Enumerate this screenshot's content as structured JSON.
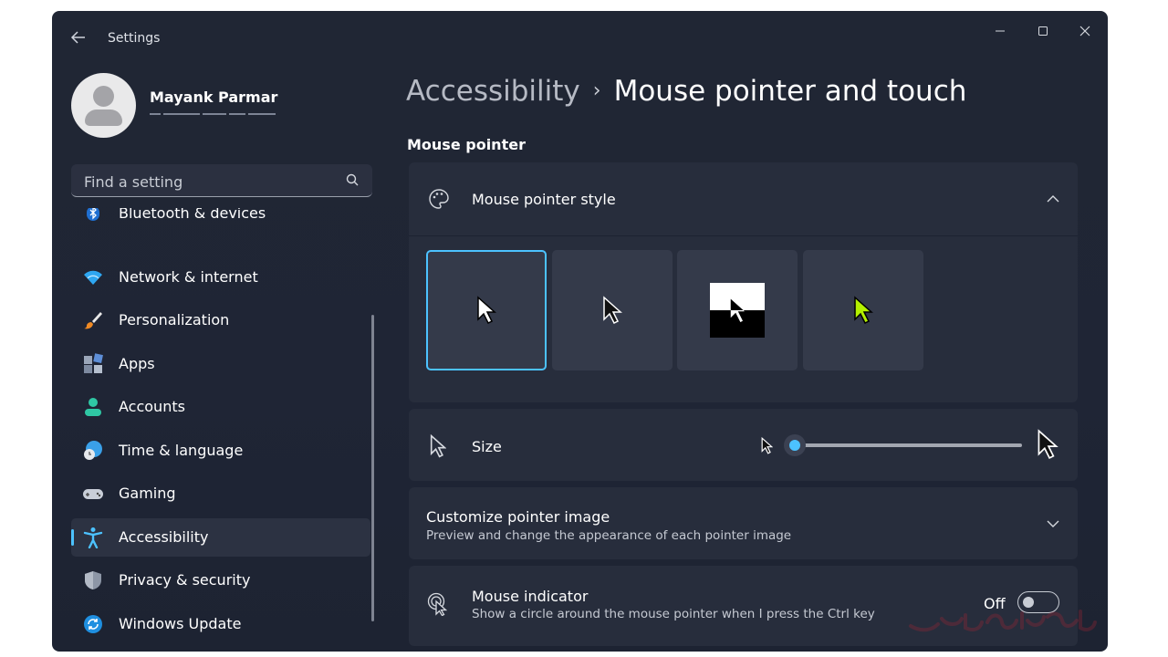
{
  "window": {
    "title": "Settings",
    "controls": [
      "minimize",
      "maximize",
      "close"
    ]
  },
  "user": {
    "name": "Mayank Parmar"
  },
  "search": {
    "placeholder": "Find a setting"
  },
  "sidebar": {
    "items": [
      {
        "label": "Bluetooth & devices",
        "icon": "bluetooth-icon"
      },
      {
        "label": "Network & internet",
        "icon": "wifi-icon"
      },
      {
        "label": "Personalization",
        "icon": "brush-icon"
      },
      {
        "label": "Apps",
        "icon": "apps-icon"
      },
      {
        "label": "Accounts",
        "icon": "person-icon"
      },
      {
        "label": "Time & language",
        "icon": "globe-clock-icon"
      },
      {
        "label": "Gaming",
        "icon": "gamepad-icon"
      },
      {
        "label": "Accessibility",
        "icon": "accessibility-icon",
        "active": true
      },
      {
        "label": "Privacy & security",
        "icon": "shield-icon"
      },
      {
        "label": "Windows Update",
        "icon": "update-icon"
      }
    ]
  },
  "breadcrumb": {
    "parent": "Accessibility",
    "separator": "›",
    "current": "Mouse pointer and touch"
  },
  "main": {
    "section_title": "Mouse pointer",
    "pointer_style": {
      "title": "Mouse pointer style",
      "expanded": true,
      "options": [
        "white",
        "black",
        "inverted",
        "custom-lime"
      ],
      "selected": "white"
    },
    "size": {
      "title": "Size",
      "value_fraction": 0.0
    },
    "customize": {
      "title": "Customize pointer image",
      "description": "Preview and change the appearance of each pointer image"
    },
    "indicator": {
      "title": "Mouse indicator",
      "description": "Show a circle around the mouse pointer when I press the Ctrl key",
      "state_label": "Off",
      "on": false
    }
  },
  "colors": {
    "accent": "#4cc2ff",
    "custom_pointer": "#b4f000",
    "background": "#202634",
    "card": "#272d3c"
  }
}
